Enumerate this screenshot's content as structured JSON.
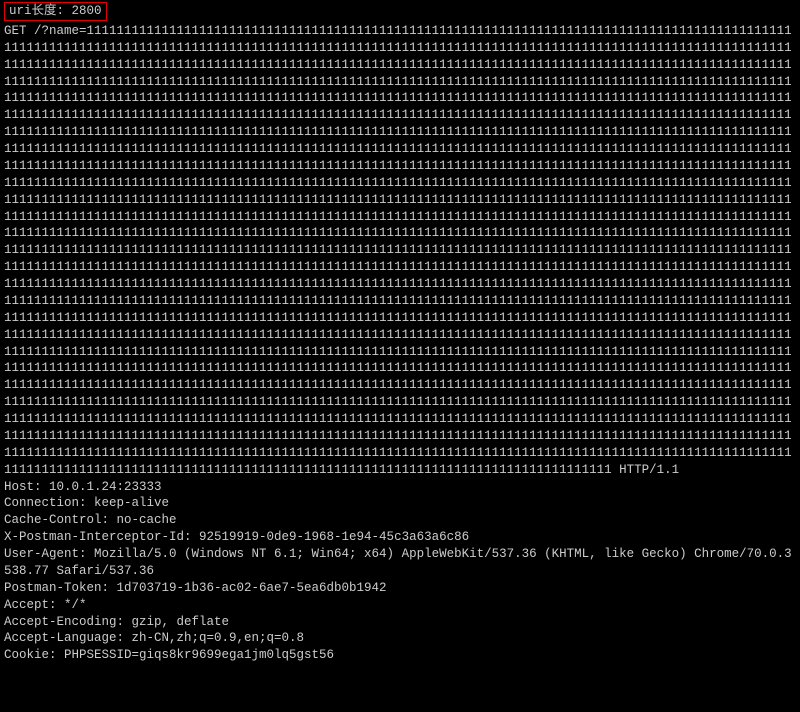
{
  "label": {
    "uri_length_label": "uri长度:",
    "uri_length_value": "2800"
  },
  "request": {
    "method": "GET",
    "path_prefix": "/?name=",
    "query_name_repeat_char": "1",
    "query_name_repeat_count": 2800,
    "http_version": "HTTP/1.1"
  },
  "headers": {
    "Host": "10.0.1.24:23333",
    "Connection": "keep-alive",
    "Cache-Control": "no-cache",
    "X-Postman-Interceptor-Id": "92519919-0de9-1968-1e94-45c3a63a6c86",
    "User-Agent": "Mozilla/5.0 (Windows NT 6.1; Win64; x64) AppleWebKit/537.36 (KHTML, like Gecko) Chrome/70.0.3538.77 Safari/537.36",
    "Postman-Token": "1d703719-1b36-ac02-6ae7-5ea6db0b1942",
    "Accept": "*/*",
    "Accept-Encoding": "gzip, deflate",
    "Accept-Language": "zh-CN,zh;q=0.9,en;q=0.8",
    "Cookie": "PHPSESSID=giqs8kr9699ega1jm0lq5gst56"
  },
  "header_order": [
    "Host",
    "Connection",
    "Cache-Control",
    "X-Postman-Interceptor-Id",
    "User-Agent",
    "Postman-Token",
    "Accept",
    "Accept-Encoding",
    "Accept-Language",
    "Cookie"
  ]
}
